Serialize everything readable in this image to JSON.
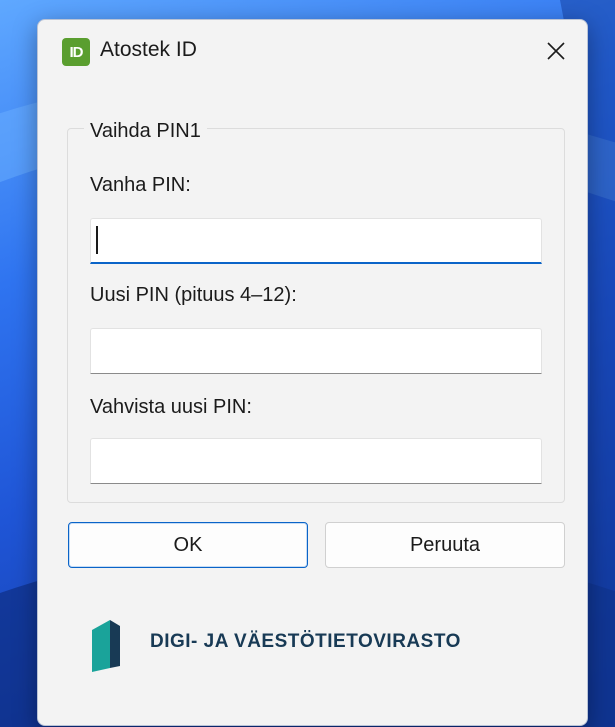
{
  "window": {
    "title": "Atostek ID",
    "app_icon_label": "ID"
  },
  "group": {
    "legend": "Vaihda PIN1"
  },
  "fields": {
    "old_pin": {
      "label": "Vanha PIN:",
      "value": ""
    },
    "new_pin": {
      "label": "Uusi PIN (pituus 4–12):",
      "value": ""
    },
    "confirm_pin": {
      "label": "Vahvista uusi PIN:",
      "value": ""
    }
  },
  "buttons": {
    "ok": "OK",
    "cancel": "Peruuta"
  },
  "footer": {
    "logo_text": "DIGI- JA VÄESTÖTIETOVIRASTO"
  },
  "colors": {
    "accent": "#0a64c8",
    "app_icon": "#5a9e2f",
    "logo_dark": "#183a55",
    "logo_teal": "#1aa39a"
  }
}
